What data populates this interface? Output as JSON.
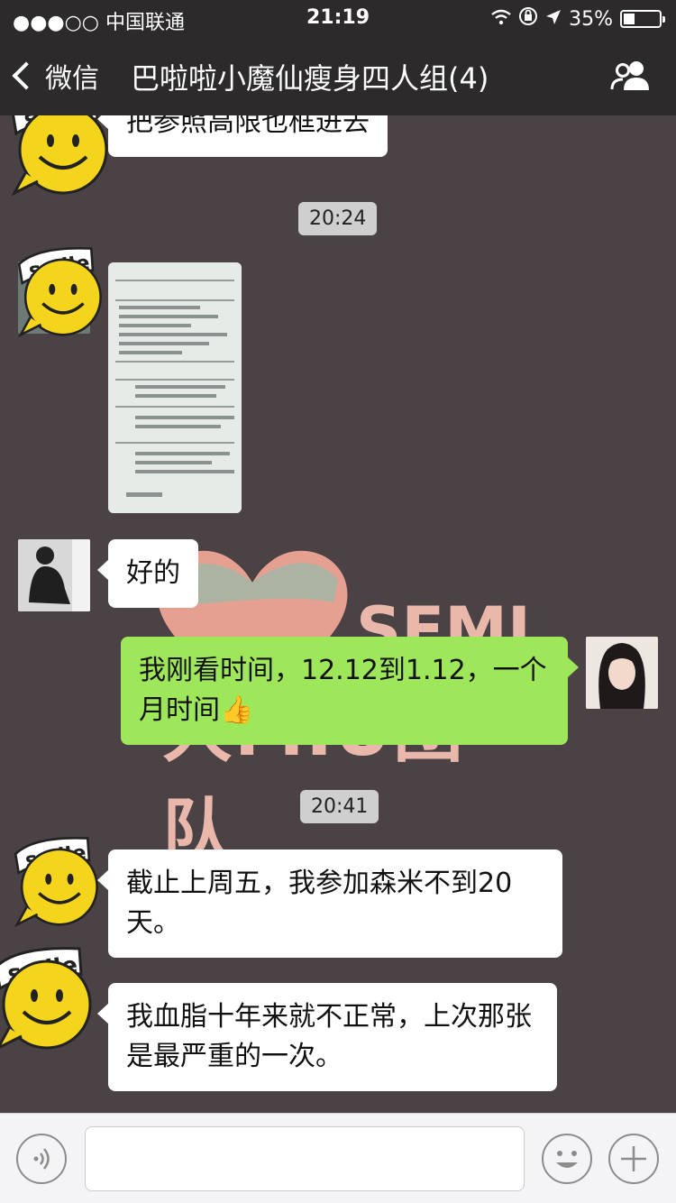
{
  "status_bar": {
    "signal": "●●●○○ 中国联通",
    "time": "21:19",
    "battery": "35%"
  },
  "nav": {
    "back_label": "微信",
    "title": "巴啦啦小魔仙瘦身四人组(4)"
  },
  "watermark": {
    "brand": "SEMI",
    "team": "大MIU团队"
  },
  "messages": [
    {
      "side": "left",
      "text": "把参照高限也框进去"
    },
    {
      "type": "time",
      "text": "20:24"
    },
    {
      "side": "left",
      "type": "image"
    },
    {
      "side": "left",
      "text": "好的"
    },
    {
      "side": "right",
      "text": "我刚看时间，12.12到1.12，一个月时间👍"
    },
    {
      "type": "time",
      "text": "20:41"
    },
    {
      "side": "left",
      "text": "截止上周五，我参加森米不到20天。"
    },
    {
      "side": "left",
      "text": "我血脂十年来就不正常，上次那张是最严重的一次。"
    }
  ],
  "sticker_text": "smile",
  "colors": {
    "bar_bg": "#2c2a2b",
    "chat_bg": "#4a4244",
    "outgoing_bubble": "#9fe75a",
    "incoming_bubble": "#ffffff"
  },
  "icons": [
    "back-chevron-icon",
    "group-members-icon",
    "voice-icon",
    "emoji-icon",
    "plus-icon"
  ]
}
